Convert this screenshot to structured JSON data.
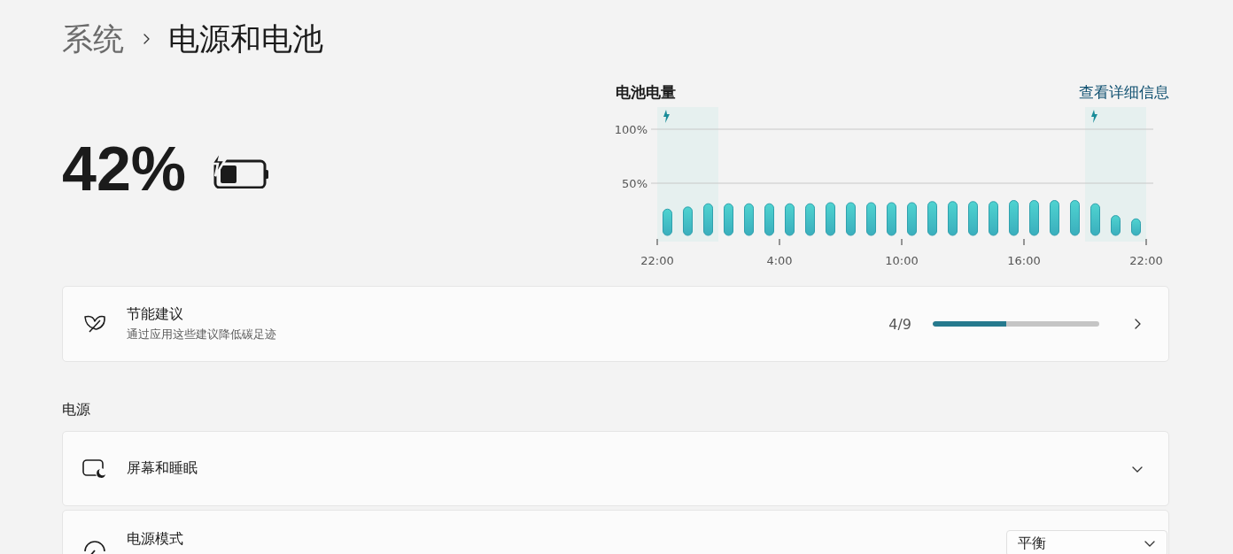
{
  "breadcrumb": [
    {
      "label": "系统",
      "selected": false
    },
    {
      "label": "电源和电池",
      "selected": true
    }
  ],
  "battery": {
    "percent": "42%",
    "charging": true
  },
  "usage": {
    "title": "电池电量",
    "link": "查看详细信息",
    "charging": [
      true,
      true,
      true,
      false,
      false,
      false,
      false,
      false,
      false,
      false,
      false,
      false,
      false,
      false,
      false,
      false,
      false,
      false,
      false,
      false,
      false,
      true,
      true,
      true
    ],
    "chart_data": {
      "type": "bar",
      "categories": [
        "22:00",
        null,
        null,
        null,
        null,
        null,
        "4:00",
        null,
        null,
        null,
        null,
        null,
        "10:00",
        null,
        null,
        null,
        null,
        null,
        "16:00",
        null,
        null,
        null,
        null,
        null,
        "22:00"
      ],
      "values": [
        26,
        28,
        31,
        31,
        31,
        31,
        31,
        31,
        32,
        32,
        32,
        32,
        32,
        33,
        33,
        33,
        33,
        34,
        34,
        34,
        34,
        31,
        20,
        17,
        null
      ],
      "ylim": [
        0,
        100
      ],
      "yticks": [
        {
          "value": 50,
          "label": "50%"
        },
        {
          "value": 100,
          "label": "100%"
        }
      ]
    }
  },
  "recommendations": {
    "title": "节能建议",
    "subtitle": "通过应用这些建议降低碳足迹",
    "count": "4/9",
    "level": 0.444
  },
  "section": "电源",
  "power_items": [
    {
      "kind": "expander",
      "title": "屏幕和睡眠"
    },
    {
      "kind": "dropdown",
      "title": "电源模式",
      "value": "平衡"
    }
  ]
}
